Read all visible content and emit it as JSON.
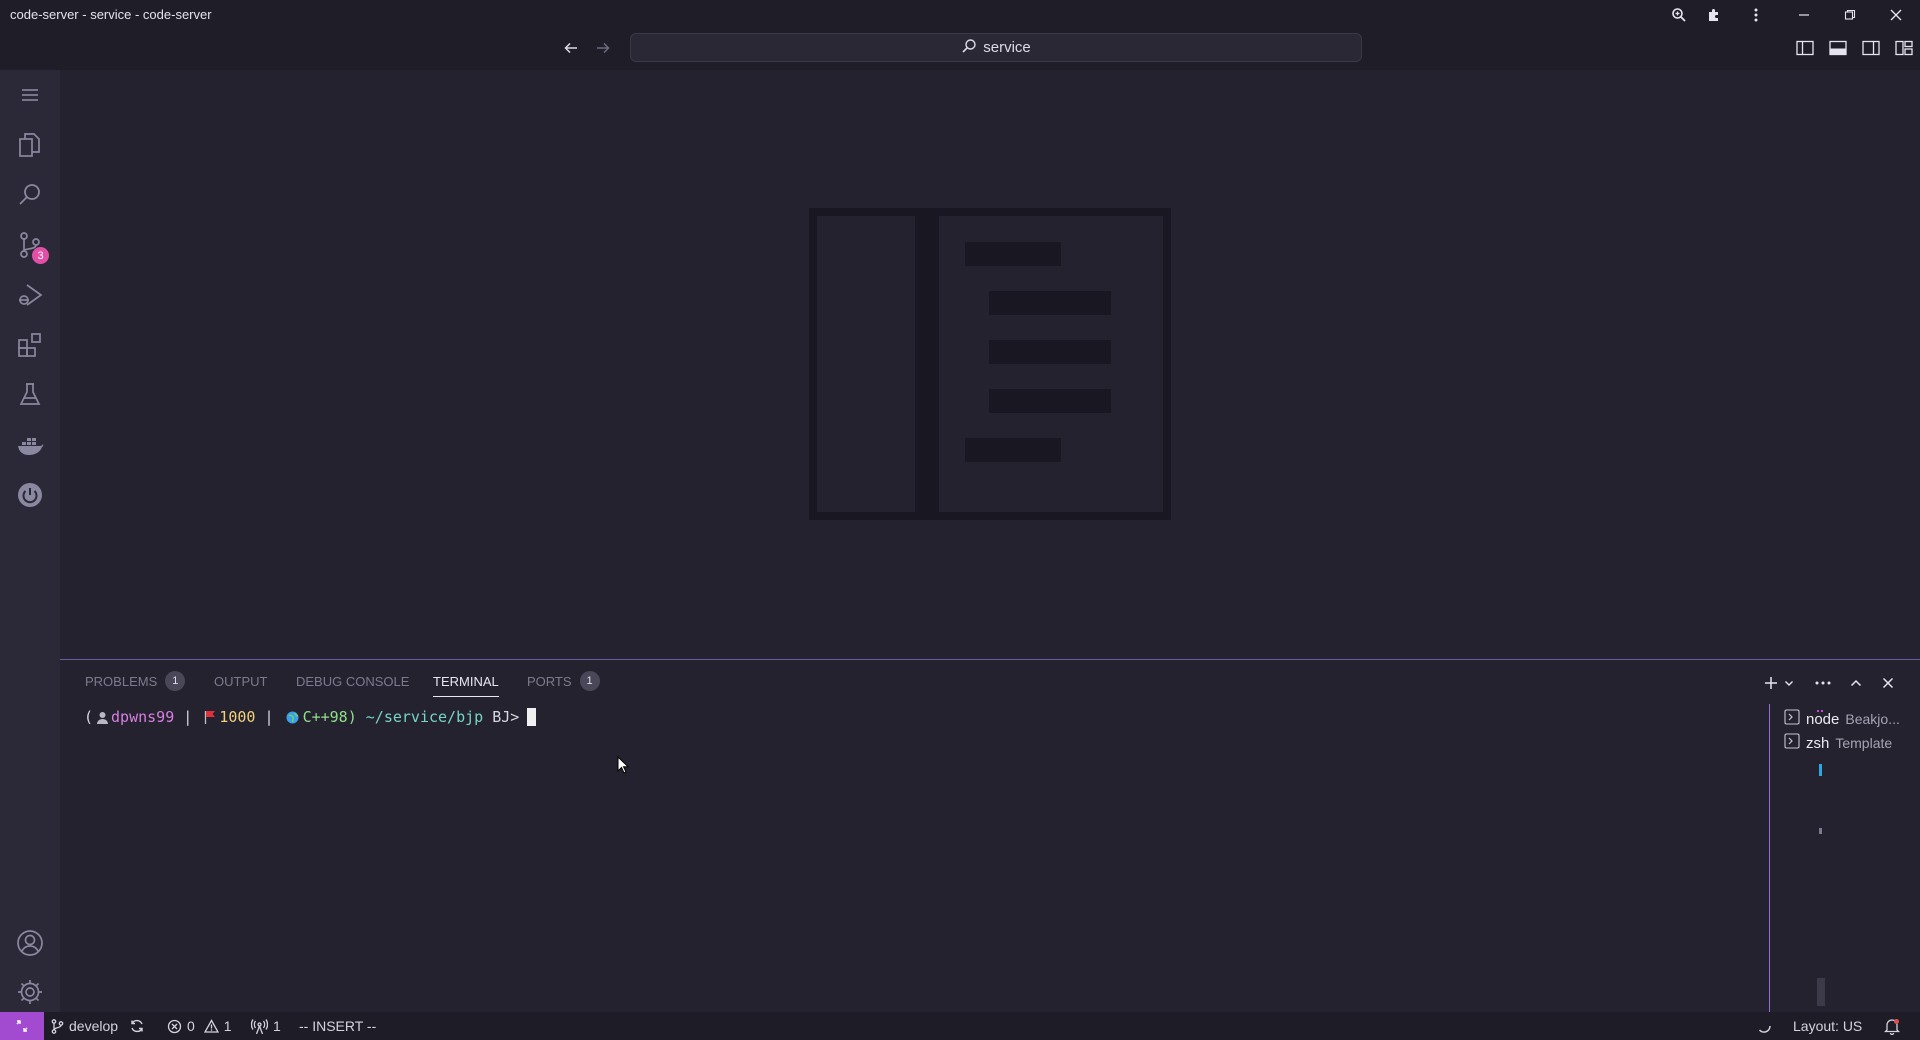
{
  "window": {
    "title": "code-server - service - code-server"
  },
  "command_center": {
    "text": "service"
  },
  "activity_bar": {
    "scm_badge": "3"
  },
  "panel": {
    "tabs": [
      {
        "label": "PROBLEMS",
        "count": "1"
      },
      {
        "label": "OUTPUT"
      },
      {
        "label": "DEBUG CONSOLE"
      },
      {
        "label": "TERMINAL",
        "active": true
      },
      {
        "label": "PORTS",
        "count": "1"
      }
    ]
  },
  "terminal": {
    "prompt": {
      "open": "(",
      "user": "dpwns99",
      "sep1": " | ",
      "number": "1000",
      "sep2": " | ",
      "lang": "C++98)",
      "path": "~/service/bjp",
      "tail": "BJ>"
    },
    "instances": [
      {
        "name": "node",
        "desc": "Beakjo..."
      },
      {
        "name": "zsh",
        "desc": "Template"
      }
    ]
  },
  "status_bar": {
    "branch": "develop",
    "errors": "0",
    "warnings": "1",
    "ports": "1",
    "mode": "-- INSERT --",
    "layout": "Layout: US"
  },
  "colors": {
    "accent": "#a24bd0",
    "badge": "#e24fa6",
    "background": "#23212e"
  }
}
